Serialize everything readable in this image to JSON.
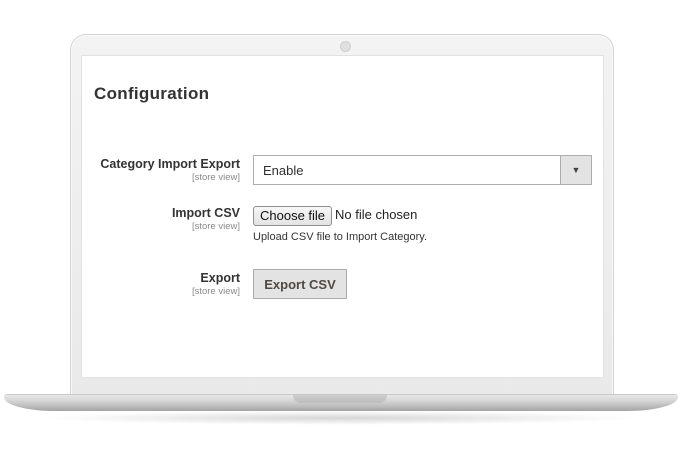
{
  "page": {
    "title": "Configuration"
  },
  "fields": [
    {
      "label": "Category Import Export",
      "scope": "[store view]",
      "value": "Enable"
    },
    {
      "label": "Import CSV",
      "scope": "[store view]",
      "button": "Choose file",
      "status": "No file chosen",
      "note": "Upload CSV file to Import Category."
    },
    {
      "label": "Export",
      "scope": "[store view]",
      "button": "Export CSV"
    }
  ],
  "icons": {
    "select_arrow": "caret-down-icon"
  },
  "colors": {
    "button_bg": "#e3e3e3",
    "border": "#adadad",
    "text": "#333333",
    "scope_text": "#8a8a8a"
  }
}
